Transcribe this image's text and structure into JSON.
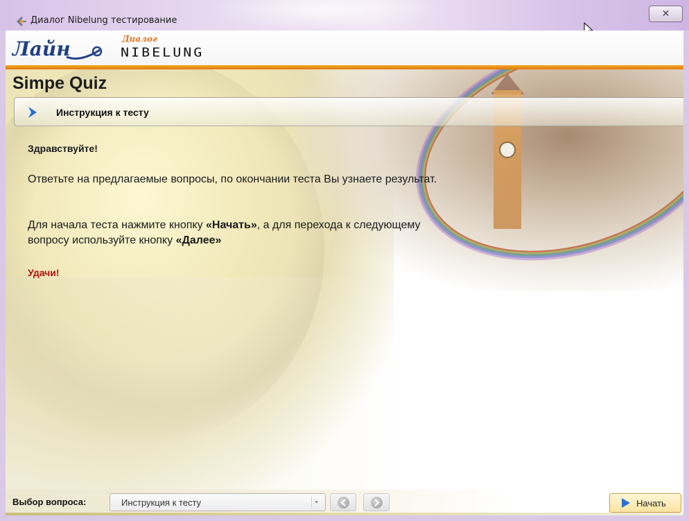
{
  "window": {
    "title": "Диалог Nibelung тестирование",
    "close_glyph": "✕"
  },
  "header": {
    "logo_brand": "Лайн",
    "logo_small": "Диалог",
    "logo_product": "NIBELUNG"
  },
  "main": {
    "quiz_title": "Simpe Quiz",
    "section_label": "Инструкция к тесту",
    "greeting": "Здравствуйте!",
    "para1": "Ответьте на предлагаемые вопросы, по окончании теста Вы узнаете результат.",
    "para2_part1": "Для начала теста нажмите кнопку ",
    "para2_bold1": "«Начать»",
    "para2_part2": ", а для перехода к следующему вопросу используйте кнопку ",
    "para2_bold2": "«Далее»",
    "luck": "Удачи!"
  },
  "footer": {
    "question_label": "Выбор вопроса:",
    "select_value": "Инструкция к тесту",
    "start_label": "Начать"
  },
  "colors": {
    "accent_orange": "#e07b10",
    "luck_red": "#b01010",
    "chevron_blue": "#2a6fd6"
  },
  "icons": {
    "app": "app-icon",
    "close": "close-icon",
    "chevron": "chevron-right-icon",
    "prev": "arrow-left-icon",
    "next": "arrow-right-icon",
    "start": "play-icon"
  }
}
